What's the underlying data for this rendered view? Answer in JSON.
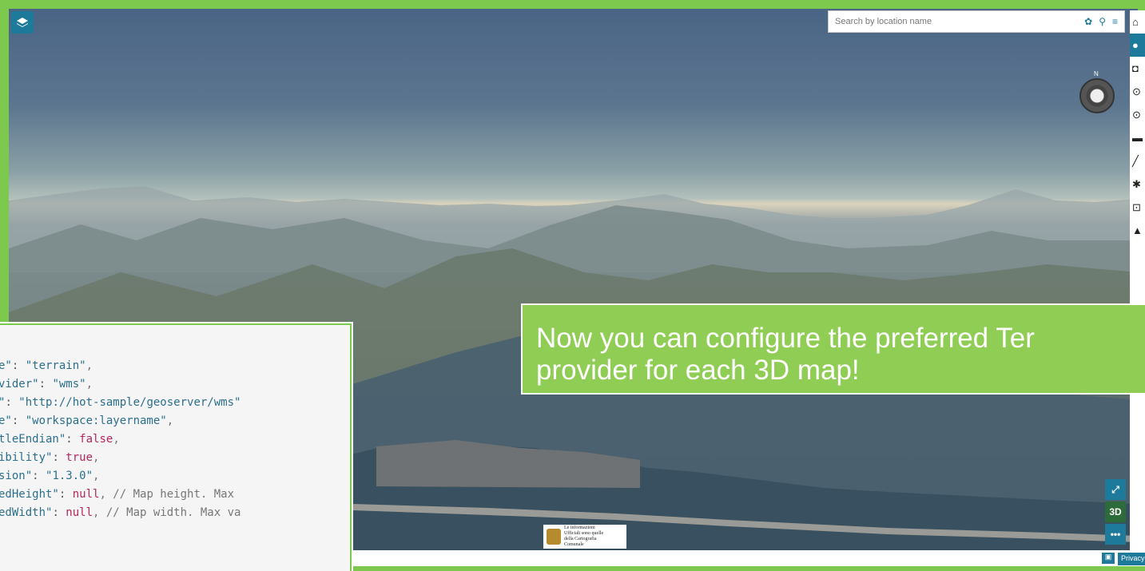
{
  "search": {
    "placeholder": "Search by location name"
  },
  "compass": {
    "north_label": "N"
  },
  "toolbar": {
    "items": [
      {
        "icon": "home-icon",
        "glyph": "⌂",
        "active": false
      },
      {
        "icon": "user-icon",
        "glyph": "●",
        "active": true
      },
      {
        "icon": "camera-icon",
        "glyph": "◘",
        "active": false
      },
      {
        "icon": "upload-icon",
        "glyph": "⊙",
        "active": false
      },
      {
        "icon": "download-icon",
        "glyph": "⊙",
        "active": false
      },
      {
        "icon": "folder-icon",
        "glyph": "▬",
        "active": false
      },
      {
        "icon": "measure-icon",
        "glyph": "╱",
        "active": false
      },
      {
        "icon": "gear-icon",
        "glyph": "✱",
        "active": false
      },
      {
        "icon": "share-icon",
        "glyph": "⊡",
        "active": false
      },
      {
        "icon": "identify-icon",
        "glyph": "▲",
        "active": false
      }
    ]
  },
  "map_controls": {
    "fullscreen": "⤢",
    "mode_3d": "3D",
    "more": "•••"
  },
  "attribution": {
    "logo_text": [
      "Le informazioni",
      "Ufficiali sono quelle",
      "della Cartografia",
      "Comunale"
    ],
    "privacy": "Privacy"
  },
  "callout": {
    "line1": "Now you can configure the preferred Ter",
    "line2": "provider for each 3D map!"
  },
  "code": {
    "lines": [
      {
        "key": "e\"",
        "value": "\"terrain\"",
        "tail": ",",
        "vtype": "s"
      },
      {
        "key": "vider\"",
        "value": "\"wms\"",
        "tail": ",",
        "vtype": "s"
      },
      {
        "key": "\"",
        "value": "\"http://hot-sample/geoserver/wms\"",
        "tail": "",
        "vtype": "s"
      },
      {
        "key": "e\"",
        "value": "\"workspace:layername\"",
        "tail": ",",
        "vtype": "s"
      },
      {
        "key": "tleEndian\"",
        "value": "false",
        "tail": ",",
        "vtype": "v"
      },
      {
        "key": "ibility\"",
        "value": "true",
        "tail": ",",
        "vtype": "v"
      },
      {
        "key": "sion\"",
        "value": "\"1.3.0\"",
        "tail": ",",
        "vtype": "s"
      },
      {
        "key": "edHeight\"",
        "value": "null",
        "tail": ", // Map height. Max",
        "vtype": "v"
      },
      {
        "key": "edWidth\"",
        "value": "null",
        "tail": ", // Map width. Max va",
        "vtype": "v"
      }
    ]
  }
}
